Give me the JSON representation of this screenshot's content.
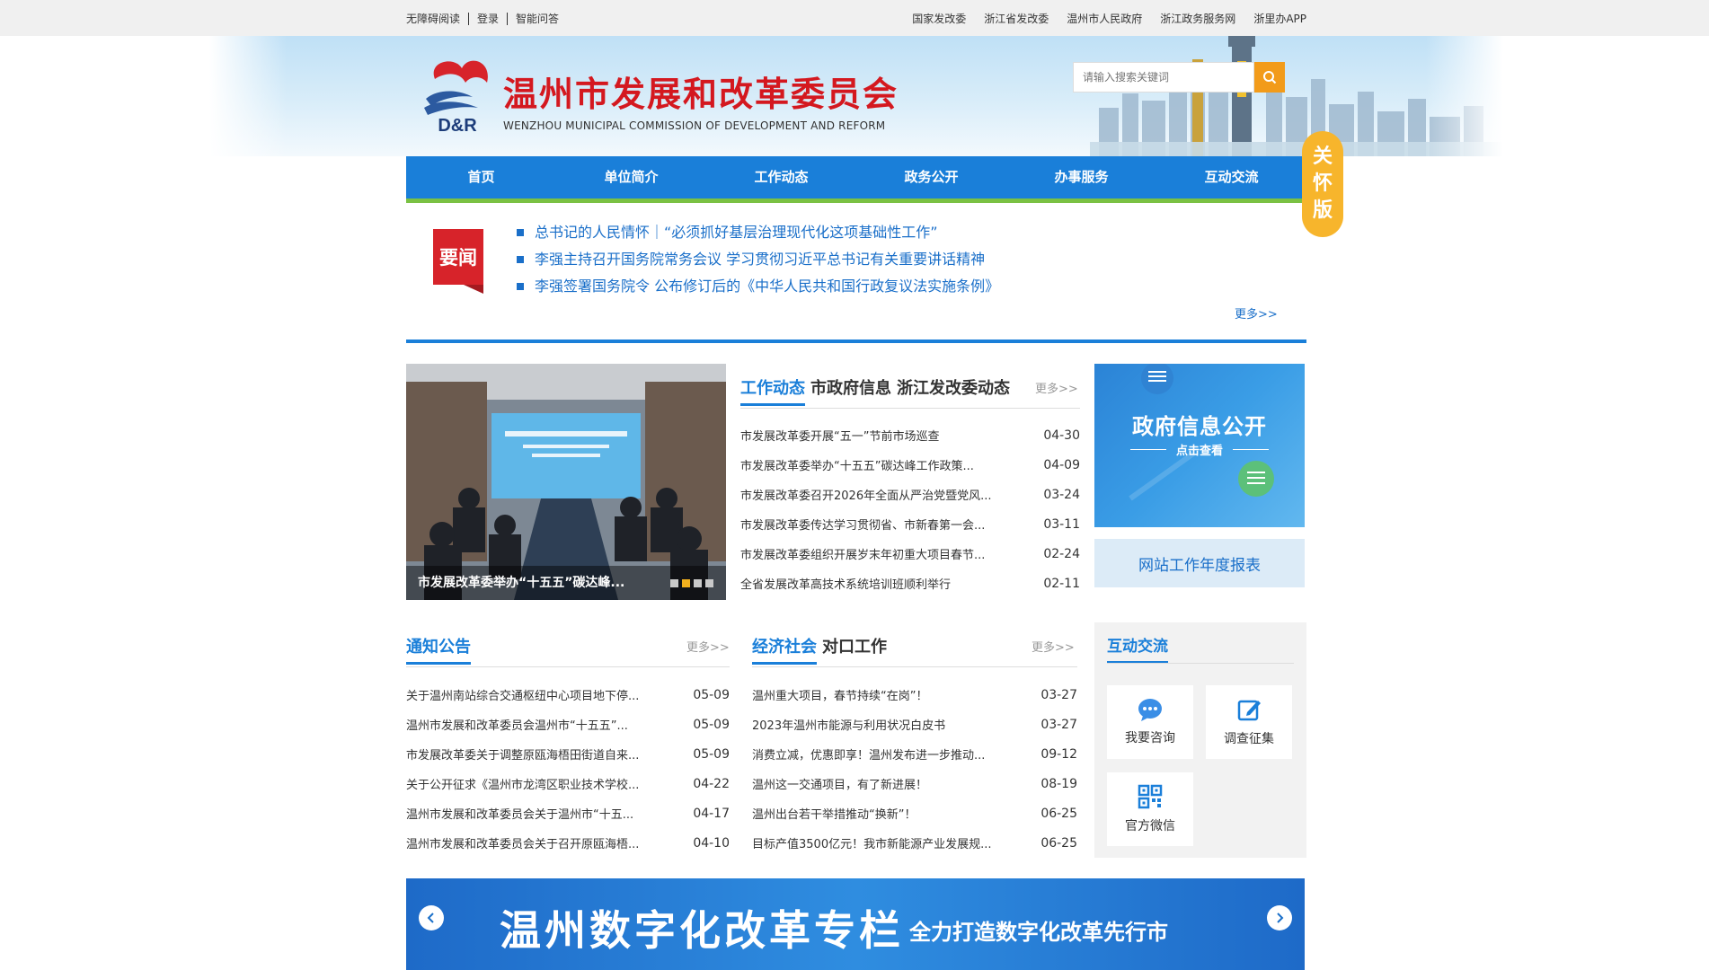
{
  "topbar": {
    "left": [
      "无障碍阅读",
      "登录",
      "智能问答"
    ],
    "right": [
      "国家发改委",
      "浙江省发改委",
      "温州市人民政府",
      "浙江政务服务网",
      "浙里办APP"
    ]
  },
  "header": {
    "title": "温州市发展和改革委员会",
    "subtitle": "WENZHOU MUNICIPAL COMMISSION OF DEVELOPMENT AND REFORM",
    "logo_text": "D&R",
    "search_placeholder": "请输入搜索关键词"
  },
  "nav": [
    "首页",
    "单位简介",
    "工作动态",
    "政务公开",
    "办事服务",
    "互动交流"
  ],
  "care_mode": [
    "关",
    "怀",
    "版"
  ],
  "news": {
    "badge": "要闻",
    "headlines": [
      "总书记的人民情怀｜“必须抓好基层治理现代化这项基础性工作”",
      "李强主持召开国务院常务会议 学习贯彻习近平总书记有关重要讲话精神",
      "李强签署国务院令 公布修订后的《中华人民共和国行政复议法实施条例》"
    ],
    "more": "更多>>"
  },
  "slideshow": {
    "caption": "市发展改革委举办“十五五”碳达峰...",
    "dots": 4,
    "active_dot": 1
  },
  "work": {
    "tabs": [
      "工作动态",
      "市政府信息",
      "浙江发改委动态"
    ],
    "more": "更多>>",
    "items": [
      {
        "text": "市发展改革委开展“五一”节前市场巡查",
        "date": "04-30"
      },
      {
        "text": "市发展改革委举办“十五五”碳达峰工作政策...",
        "date": "04-09"
      },
      {
        "text": "市发展改革委召开2026年全面从严治党暨党风...",
        "date": "03-24"
      },
      {
        "text": "市发展改革委传达学习贯彻省、市新春第一会...",
        "date": "03-11"
      },
      {
        "text": "市发展改革委组织开展岁末年初重大项目春节...",
        "date": "02-24"
      },
      {
        "text": "全省发展改革高技术系统培训班顺利举行",
        "date": "02-11"
      }
    ]
  },
  "govinfo": {
    "title": "政府信息公开",
    "sub": "点击查看"
  },
  "annual_report": "网站工作年度报表",
  "notice": {
    "tabs": [
      "通知公告"
    ],
    "more": "更多>>",
    "items": [
      {
        "text": "关于温州南站综合交通枢纽中心项目地下停...",
        "date": "05-09"
      },
      {
        "text": "温州市发展和改革委员会温州市“十五五”...",
        "date": "05-09"
      },
      {
        "text": "市发展改革委关于调整原瓯海梧田街道自来...",
        "date": "05-09"
      },
      {
        "text": "关于公开征求《温州市龙湾区职业技术学校...",
        "date": "04-22"
      },
      {
        "text": "温州市发展和改革委员会关于温州市“十五...",
        "date": "04-17"
      },
      {
        "text": "温州市发展和改革委员会关于召开原瓯海梧...",
        "date": "04-10"
      }
    ]
  },
  "economy": {
    "tabs": [
      "经济社会",
      "对口工作"
    ],
    "more": "更多>>",
    "items": [
      {
        "text": "温州重大项目，春节持续“在岗”！",
        "date": "03-27"
      },
      {
        "text": "2023年温州市能源与利用状况白皮书",
        "date": "03-27"
      },
      {
        "text": "消费立减，优惠即享！温州发布进一步推动...",
        "date": "09-12"
      },
      {
        "text": "温州这一交通项目，有了新进展！",
        "date": "08-19"
      },
      {
        "text": "温州出台若干举措推动“换新”！",
        "date": "06-25"
      },
      {
        "text": "目标产值3500亿元！我市新能源产业发展规...",
        "date": "06-25"
      }
    ]
  },
  "interact": {
    "title": "互动交流",
    "cards": [
      "我要咨询",
      "调查征集",
      "官方微信"
    ]
  },
  "banner": {
    "title": "温州数字化改革专栏",
    "sub": "全力打造数字化改革先行市"
  },
  "colors": {
    "primary": "#1a7fd9",
    "red": "#d4181f",
    "orange": "#f29b1a",
    "green": "#7ac143"
  }
}
